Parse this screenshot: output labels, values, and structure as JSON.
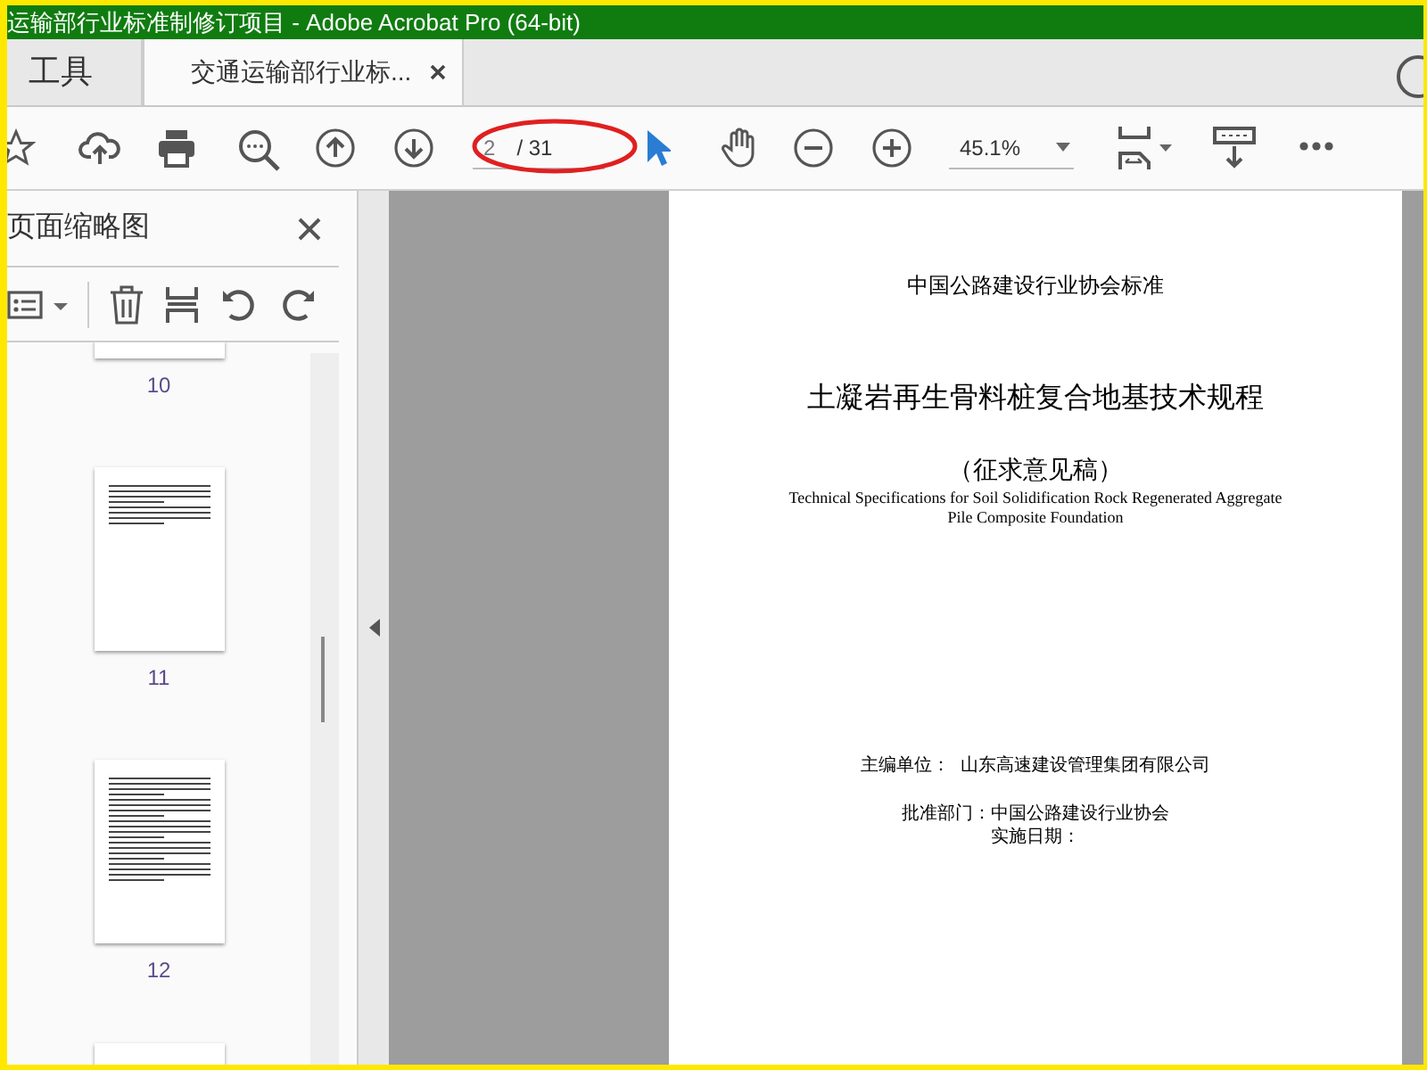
{
  "window": {
    "title": "运输部行业标准制修订项目 - Adobe Acrobat Pro (64-bit)"
  },
  "tabs": [
    {
      "label": "工具",
      "kind": "home",
      "selected": false
    },
    {
      "label": "交通运输部行业标...",
      "kind": "document",
      "selected": true
    }
  ],
  "toolbar": {
    "page_current": "2",
    "page_total": "/ 31",
    "zoom": "45.1%"
  },
  "thumbnail_panel": {
    "title": "页面缩略图",
    "pages": [
      {
        "label": "10",
        "kind": "cut"
      },
      {
        "label": "11",
        "kind": "short"
      },
      {
        "label": "12",
        "kind": "long"
      }
    ]
  },
  "document": {
    "lines": [
      {
        "kind": "header",
        "text": "中国公路建设行业协会标准"
      },
      {
        "kind": "title",
        "text": "土凝岩再生骨料桩复合地基技术规程"
      },
      {
        "kind": "subtitle",
        "text": "（征求意见稿）"
      },
      {
        "kind": "english",
        "text": "Technical Specifications for Soil Solidification Rock Regenerated Aggregate"
      },
      {
        "kind": "english_cont",
        "text": "Pile Composite Foundation"
      },
      {
        "kind": "editor",
        "text": "主编单位：  山东高速建设管理集团有限公司"
      },
      {
        "kind": "approver",
        "text": "批准部门：中国公路建设行业协会"
      },
      {
        "kind": "date",
        "text": "实施日期："
      }
    ]
  }
}
